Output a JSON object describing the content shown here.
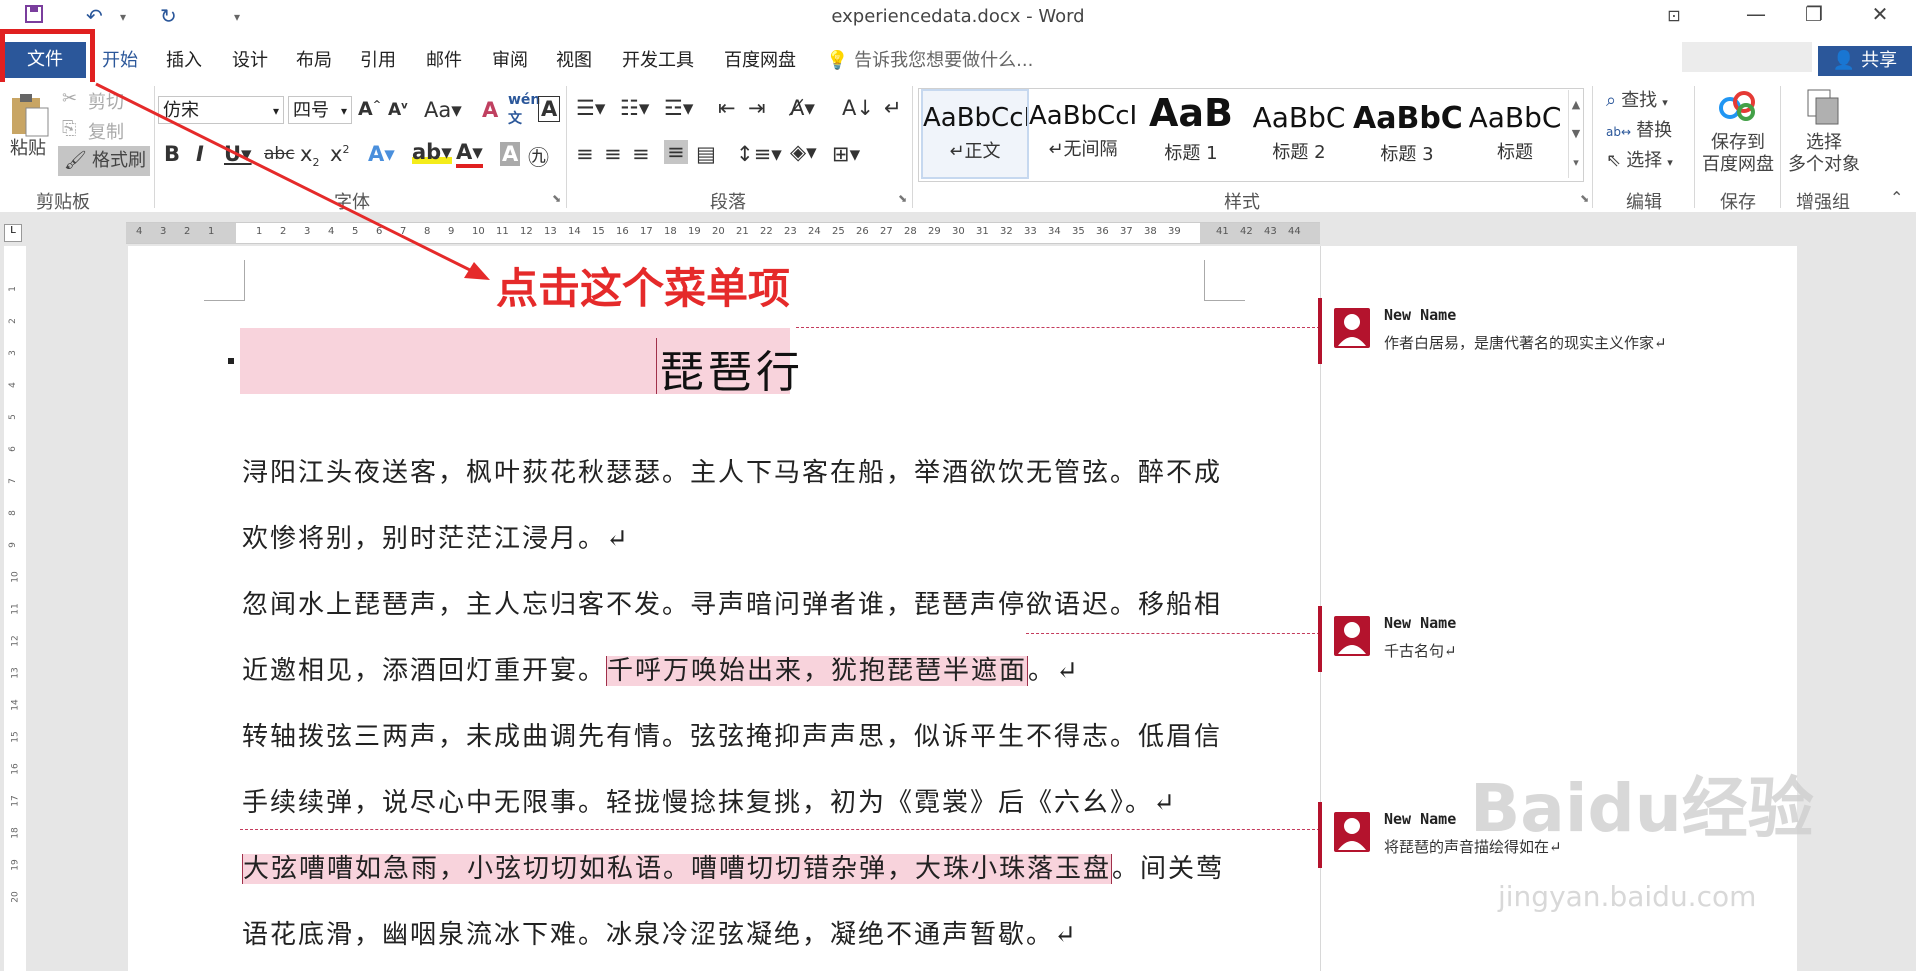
{
  "titlebar": {
    "doc_title": "experiencedata.docx - Word",
    "save_icon": "save-icon",
    "undo_icon": "undo-icon",
    "redo_icon": "redo-icon"
  },
  "tabs": {
    "file": "文件",
    "items": [
      "开始",
      "插入",
      "设计",
      "布局",
      "引用",
      "邮件",
      "审阅",
      "视图",
      "开发工具",
      "百度网盘"
    ],
    "tell_me": "告诉我您想要做什么...",
    "share": "共享"
  },
  "ribbon": {
    "clipboard": {
      "paste": "粘贴",
      "cut": "剪切",
      "copy": "复制",
      "format_painter": "格式刷",
      "label": "剪贴板"
    },
    "font": {
      "name": "仿宋",
      "size": "四号",
      "label": "字体"
    },
    "paragraph": {
      "label": "段落"
    },
    "styles": {
      "label": "样式",
      "items": [
        {
          "sample": "AaBbCcI",
          "name": "↵正文"
        },
        {
          "sample": "AaBbCcI",
          "name": "↵无间隔"
        },
        {
          "sample": "AaB",
          "name": "标题 1"
        },
        {
          "sample": "AaBbC",
          "name": "标题 2"
        },
        {
          "sample": "AaBbC",
          "name": "标题 3"
        },
        {
          "sample": "AaBbC",
          "name": "标题"
        }
      ]
    },
    "editing": {
      "find": "查找",
      "replace": "替换",
      "select": "选择",
      "label": "编辑"
    },
    "save": {
      "line1": "保存到",
      "line2": "百度网盘",
      "label": "保存"
    },
    "select_objects": {
      "line1": "选择",
      "line2": "多个对象",
      "label": "增强组"
    }
  },
  "annotation": "点击这个菜单项",
  "document": {
    "heading": "琵琶行",
    "paragraphs": [
      "浔阳江头夜送客，枫叶荻花秋瑟瑟。主人下马客在船，举酒欲饮无管弦。醉不成",
      "欢惨将别，别时茫茫江浸月。↵",
      "忽闻水上琵琶声，主人忘归客不发。寻声暗问弹者谁，琵琶声停欲语迟。移船相",
      "近邀相见，添酒回灯重开宴。",
      "千呼万唤始出来，犹抱琵琶半遮面",
      "。↵",
      "转轴拨弦三两声，未成曲调先有情。弦弦掩抑声声思，似诉平生不得志。低眉信",
      "手续续弹，说尽心中无限事。轻拢慢捻抹复挑，初为《霓裳》后《六幺》。↵",
      "大弦嘈嘈如急雨，小弦切切如私语。嘈嘈切切错杂弹，大珠小珠落玉盘",
      "。间关莺",
      "语花底滑，幽咽泉流冰下难。冰泉冷涩弦凝绝，凝绝不通声暂歇。↵"
    ]
  },
  "comments": [
    {
      "author": "New Name",
      "text": "作者白居易，是唐代著名的现实主义作家↵"
    },
    {
      "author": "New Name",
      "text": "千古名句↵"
    },
    {
      "author": "New Name",
      "text": "将琵琶的声音描绘得如在↵"
    }
  ],
  "watermark": {
    "line1": "Baidu经验",
    "line2": "jingyan.baidu.com"
  },
  "colors": {
    "accent": "#2b579a",
    "annotation": "#e52a2a",
    "comment": "#b4132d",
    "highlight": "#f8d3dc"
  }
}
